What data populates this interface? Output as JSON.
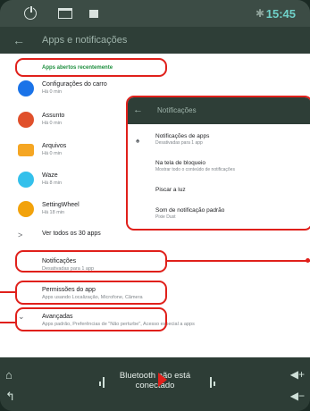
{
  "status_bar": {
    "time": "15:45"
  },
  "app_bar": {
    "back_glyph": "←",
    "title": "Apps e notificações"
  },
  "recent_section": {
    "title": "Apps abertos recentemente"
  },
  "recent_apps": [
    {
      "name": "Configurações do carro",
      "time": "Há 0 min",
      "color": "#1a73e8",
      "icon": "car-settings-icon"
    },
    {
      "name": "Assunto",
      "time": "Há 0 min",
      "color": "#e0502b",
      "icon": "assunto-icon"
    },
    {
      "name": "Arquivos",
      "time": "Há 0 min",
      "color": "#f5a623",
      "icon": "folder-icon"
    },
    {
      "name": "Waze",
      "time": "Há 8 min",
      "color": "#34c0eb",
      "icon": "waze-icon"
    },
    {
      "name": "SettingWheel",
      "time": "Há 18 min",
      "color": "#f2a20b",
      "icon": "setting-wheel-icon"
    }
  ],
  "see_all": {
    "label": "Ver todos os 30 apps",
    "glyph": ">"
  },
  "notifications": {
    "title": "Notificações",
    "subtitle": "Desativadas para 1 app"
  },
  "permissions": {
    "title": "Permissões do app",
    "subtitle": "Apps usando Localização, Microfone, Câmera"
  },
  "advanced": {
    "title": "Avançadas",
    "subtitle": "Apps padrão, Preferências de \"Não perturbe\", Acesso especial a apps",
    "glyph": "⌄"
  },
  "popup": {
    "back_glyph": "←",
    "title": "Notificações",
    "rows": [
      {
        "title": "Notificações de apps",
        "subtitle": "Desativadas para 1 app"
      },
      {
        "title": "Na tela de bloqueio",
        "subtitle": "Mostrar todo o conteúdo de notificações"
      },
      {
        "title": "Piscar a luz",
        "subtitle": ""
      },
      {
        "title": "Som de notificação padrão",
        "subtitle": "Pixie Dust"
      }
    ]
  },
  "navbar": {
    "bluetooth_status": "Bluetooth não está conectado"
  },
  "colors": {
    "highlight": "#e0201b",
    "accent_green": "#1e8e3e",
    "time": "#6fd0c8"
  }
}
